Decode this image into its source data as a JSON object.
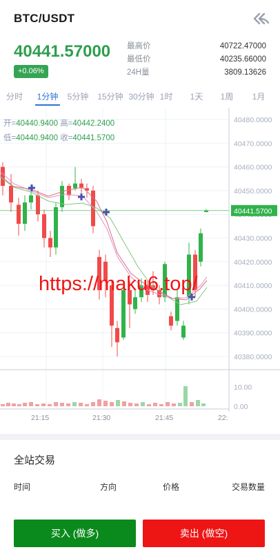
{
  "header": {
    "pair": "BTC/USDT",
    "back_icon": "double-chevron-back-icon"
  },
  "ticker": {
    "price": "40441.57000",
    "change": "+0.06%",
    "stats": [
      {
        "label": "最高价",
        "value": "40722.47000"
      },
      {
        "label": "最低价",
        "value": "40235.66000"
      },
      {
        "label": "24H量",
        "value": "3809.13626"
      }
    ]
  },
  "tabs": [
    {
      "label": "分时",
      "active": false
    },
    {
      "label": "1分钟",
      "active": true
    },
    {
      "label": "5分钟",
      "active": false
    },
    {
      "label": "15分钟",
      "active": false
    },
    {
      "label": "30分钟",
      "active": false
    },
    {
      "label": "1时",
      "active": false
    },
    {
      "label": "1天",
      "active": false
    },
    {
      "label": "1周",
      "active": false
    },
    {
      "label": "1月",
      "active": false
    }
  ],
  "ohlc": {
    "open_label": "开=",
    "open": "40440.9400",
    "high_label": "高=",
    "high": "40442.2400",
    "low_label": "低=",
    "low": "40440.9400",
    "close_label": "收=",
    "close": "40441.5700"
  },
  "watermark": "https://maku6.top/",
  "chart_data": {
    "type": "candlestick",
    "price_axis": [
      "40480.0000",
      "40470.0000",
      "40460.0000",
      "40450.0000",
      "40440.0000",
      "40430.0000",
      "40420.0000",
      "40410.0000",
      "40400.0000",
      "40390.0000",
      "40380.0000"
    ],
    "ylim": [
      40375,
      40484
    ],
    "current_price_label": "40441.5700",
    "current_price": 40441.57,
    "volume_axis": [
      "10.00",
      "0.00"
    ],
    "time_axis": [
      "21:15",
      "21:30",
      "21:45",
      "22:"
    ],
    "colors": {
      "up": "#2fb34a",
      "down": "#f04a4a",
      "ma1": "#e28cc6",
      "ma2": "#7ec87e",
      "ma3": "#d77080",
      "marker": "#4a4fb0",
      "grid": "#eef1f5",
      "price_line": "#2fb34a"
    }
  },
  "trades": {
    "title": "全站交易",
    "columns": [
      "时间",
      "方向",
      "价格",
      "交易数量"
    ]
  },
  "actions": {
    "buy": "买入 (做多)",
    "sell": "卖出 (做空)"
  }
}
